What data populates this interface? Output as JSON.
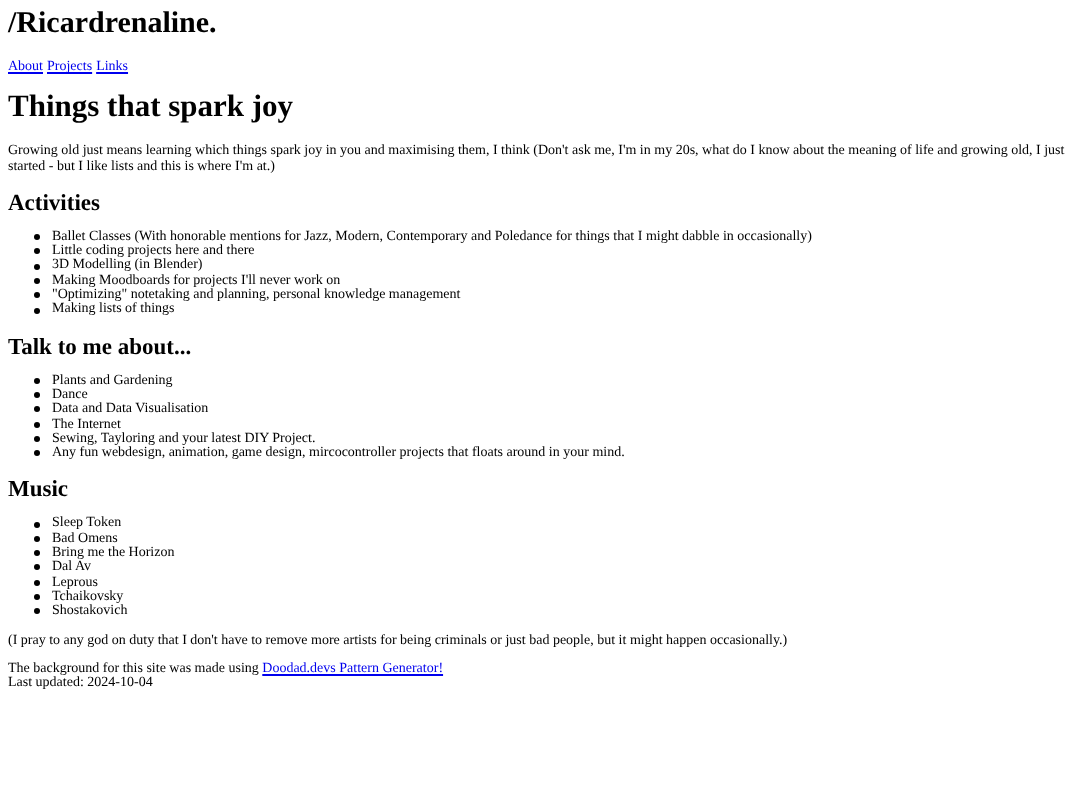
{
  "site_title": "/Ricardrenaline.",
  "nav": [
    "About",
    "Projects",
    "Links"
  ],
  "heading": "Things that spark joy",
  "intro": "Growing old just means learning which things spark joy in you and maximising them, I think (Don't ask me, I'm in my 20s, what do I know about the meaning of life and growing old, I just started - but I like lists and this is where I'm at.)",
  "sections": [
    {
      "heading": "Activities",
      "items": [
        "Ballet Classes (With honorable mentions for Jazz, Modern, Contemporary and Poledance for things that I might dabble in occasionally)",
        "Little coding projects here and there",
        "3D Modelling (in Blender)",
        "Making Moodboards for projects I'll never work on",
        "\"Optimizing\" notetaking and planning, personal knowledge management",
        "Making lists of things"
      ]
    },
    {
      "heading": "Talk to me about...",
      "items": [
        "Plants and Gardening",
        "Dance",
        "Data and Data Visualisation",
        "The Internet",
        "Sewing, Tayloring and your latest DIY Project.",
        "Any fun webdesign, animation, game design, mircocontroller projects that floats around in your mind."
      ]
    },
    {
      "heading": "Music",
      "items": [
        "Sleep Token",
        "Bad Omens",
        "Bring me the Horizon",
        "Dal Av",
        "Leprous",
        "Tchaikovsky",
        "Shostakovich"
      ]
    }
  ],
  "note": "(I pray to any god on duty that I don't have to remove more artists for being criminals or just bad people, but it might happen occasionally.)",
  "footer": {
    "text": "The background for this site was made using",
    "link": "Doodad.devs Pattern Generator!"
  },
  "last_updated": "Last updated: 2024-10-04"
}
